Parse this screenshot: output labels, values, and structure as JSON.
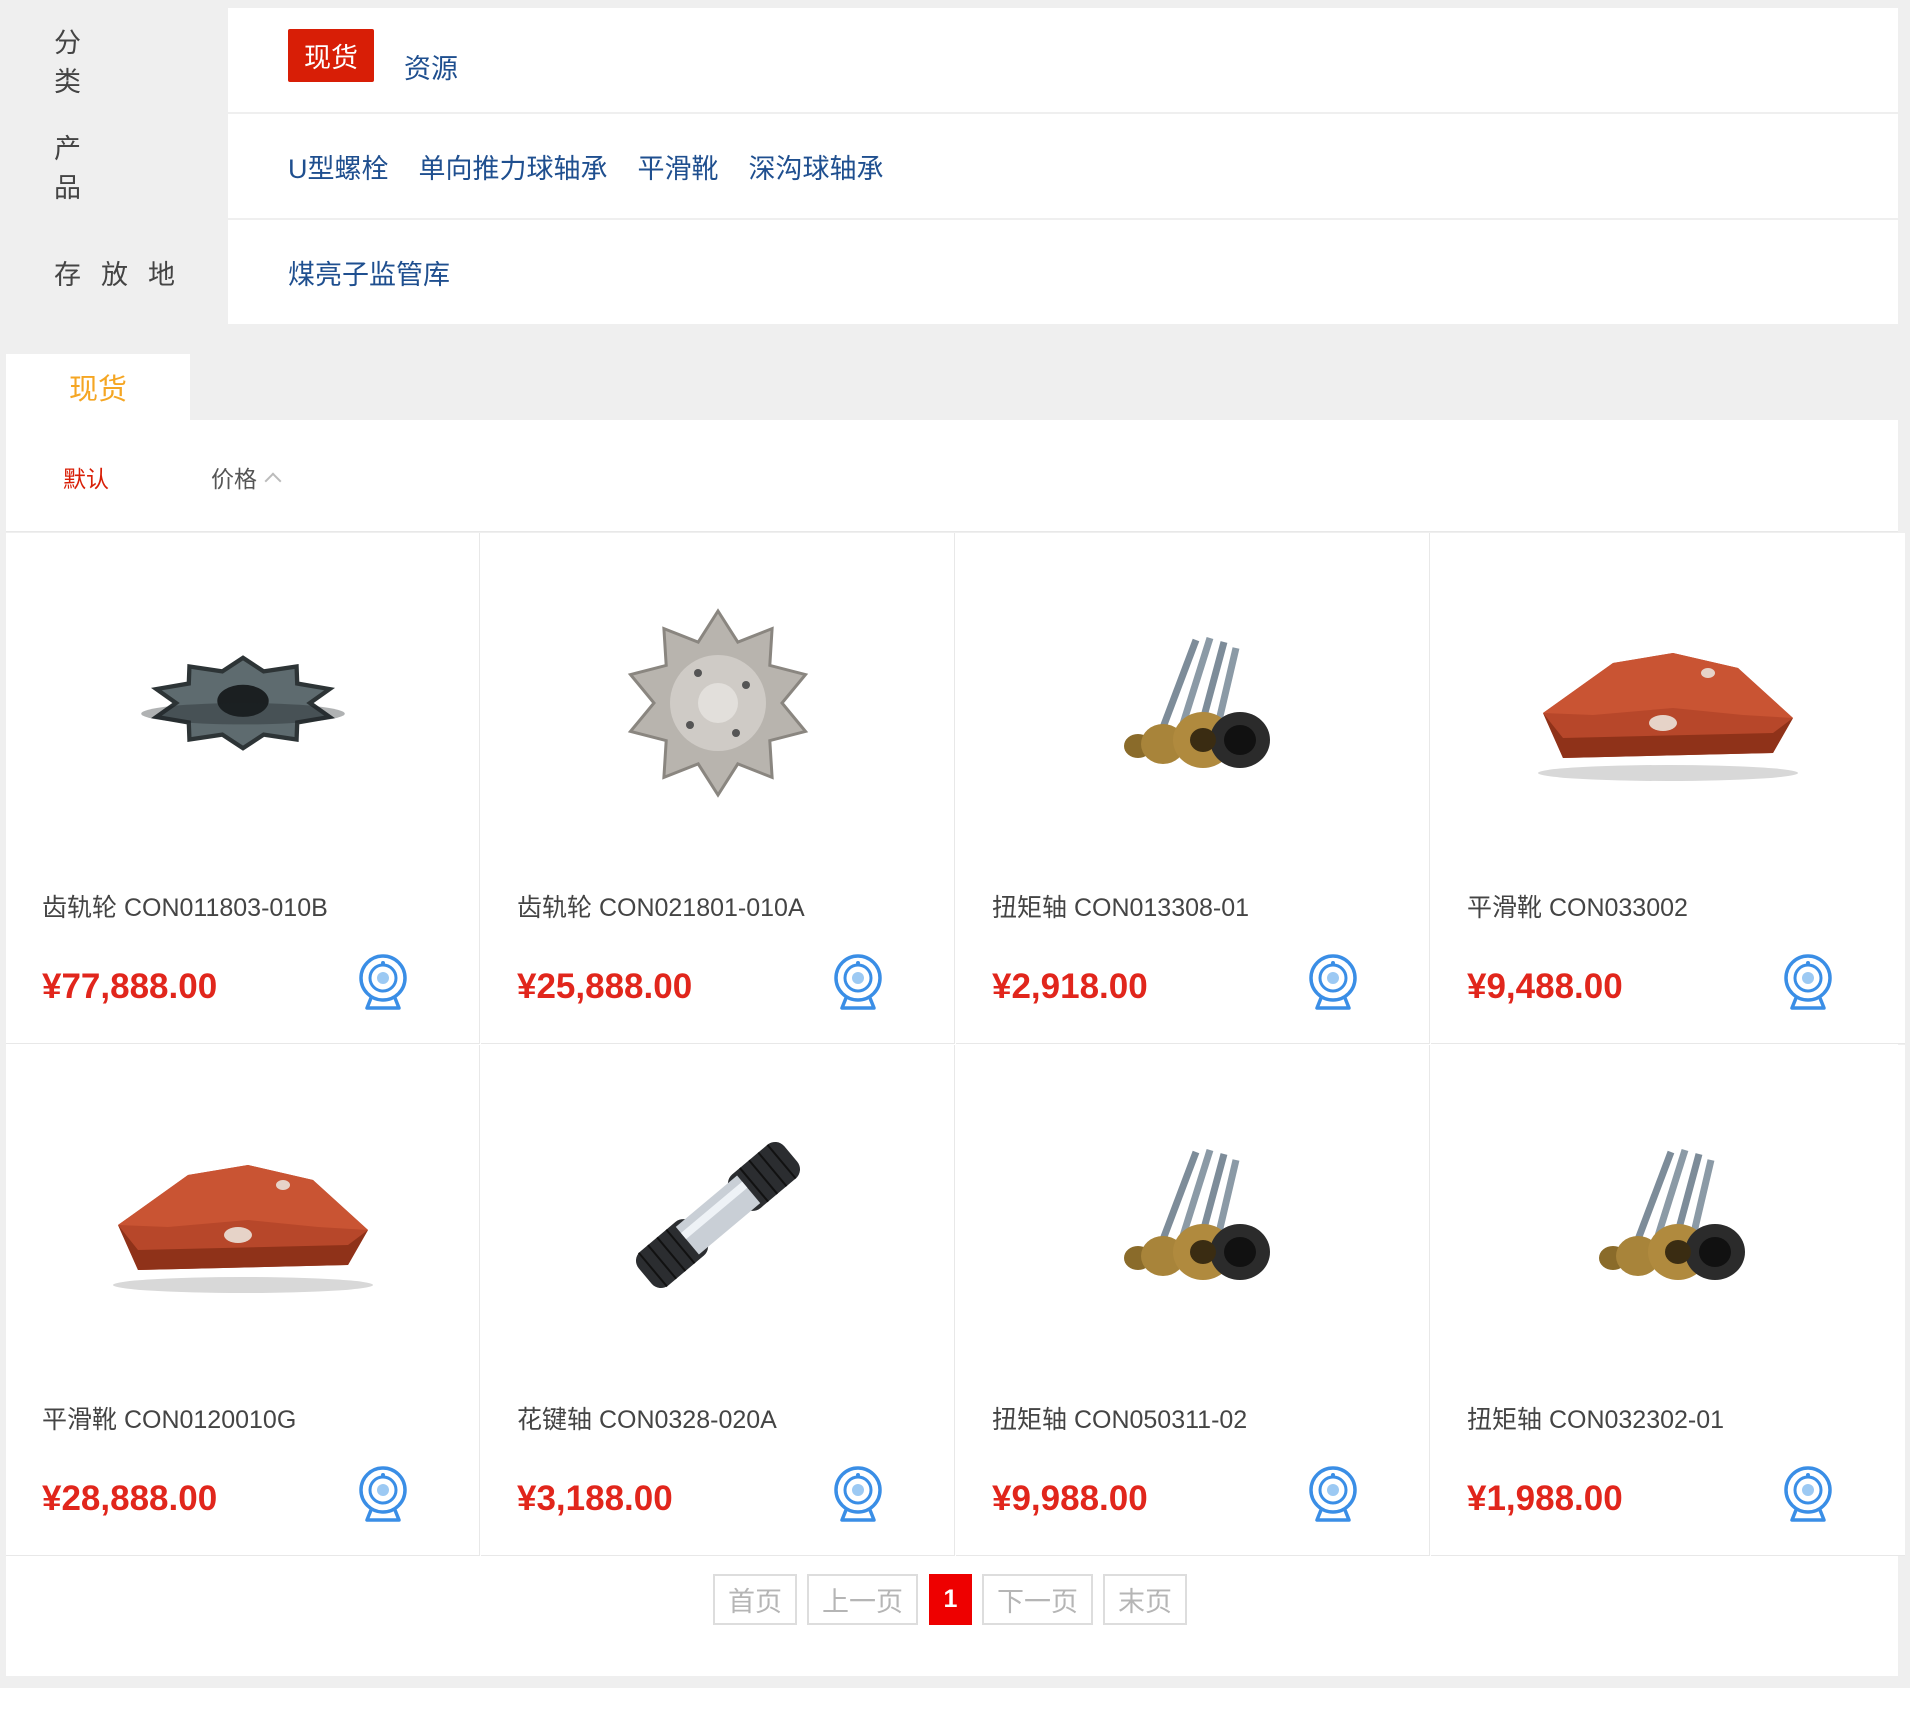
{
  "filters": {
    "category": {
      "label": "分类",
      "options": [
        "现货",
        "资源"
      ],
      "active_index": 0
    },
    "product": {
      "label": "产品",
      "options": [
        "U型螺栓",
        "单向推力球轴承",
        "平滑靴",
        "深沟球轴承"
      ]
    },
    "location": {
      "label": "存放地",
      "options": [
        "煤亮子监管库"
      ]
    }
  },
  "tabs": {
    "active": "现货"
  },
  "sort": {
    "default_label": "默认",
    "price_label": "价格"
  },
  "products": [
    {
      "name": "齿轨轮 CON011803-010B",
      "price": "¥77,888.00",
      "image": "sprocket-gear-dark"
    },
    {
      "name": "齿轨轮 CON021801-010A",
      "price": "¥25,888.00",
      "image": "sprocket-gear-silver"
    },
    {
      "name": "扭矩轴 CON013308-01",
      "price": "¥2,918.00",
      "image": "torque-shaft-bundle"
    },
    {
      "name": "平滑靴 CON033002",
      "price": "¥9,488.00",
      "image": "sliding-shoe-red"
    },
    {
      "name": "平滑靴 CON0120010G",
      "price": "¥28,888.00",
      "image": "sliding-shoe-red"
    },
    {
      "name": "花键轴 CON0328-020A",
      "price": "¥3,188.00",
      "image": "spline-shaft"
    },
    {
      "name": "扭矩轴 CON050311-02",
      "price": "¥9,988.00",
      "image": "torque-shaft-bundle"
    },
    {
      "name": "扭矩轴 CON032302-01",
      "price": "¥1,988.00",
      "image": "torque-shaft-bundle"
    }
  ],
  "pagination": {
    "first": "首页",
    "prev": "上一页",
    "current": "1",
    "next": "下一页",
    "last": "末页"
  },
  "colors": {
    "accent_red": "#d81e06",
    "price_red": "#e1261c",
    "link_blue": "#1f4f8f",
    "tab_orange": "#f5a623",
    "icon_blue": "#3a8ee6"
  }
}
